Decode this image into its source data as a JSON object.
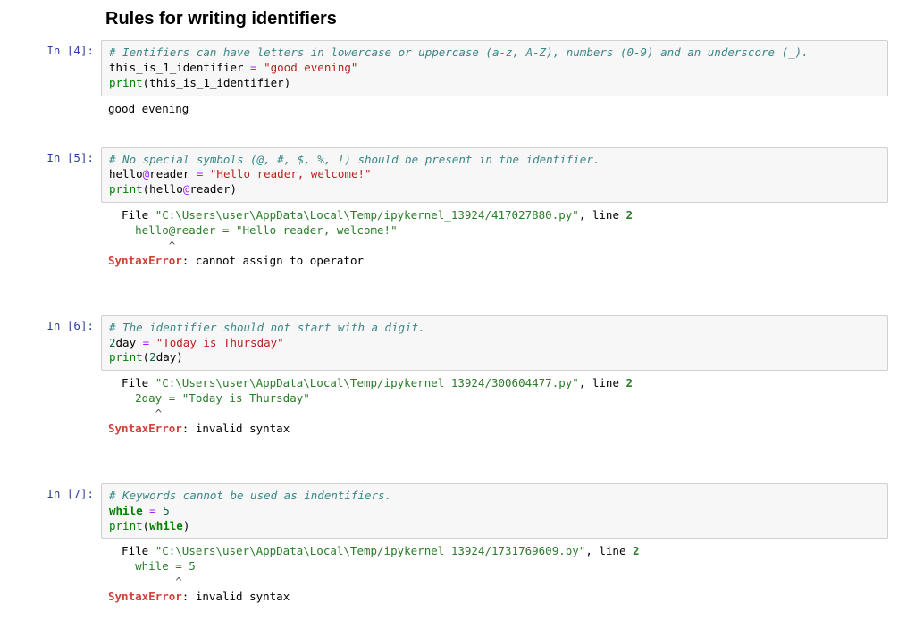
{
  "heading": "Rules for writing identifiers",
  "cells": {
    "c4": {
      "prompt": "In [4]:",
      "code": {
        "comment": "# Ientifiers can have letters in lowercase or uppercase (a-z, A-Z), numbers (0-9) and an underscore (_).",
        "l2_name": "this_is_1_identifier",
        "l2_eq": " = ",
        "l2_str": "\"good evening\"",
        "l3_fn": "print",
        "l3_open": "(",
        "l3_arg": "this_is_1_identifier",
        "l3_close": ")"
      },
      "output_text": "good evening"
    },
    "c5": {
      "prompt": "In [5]:",
      "code": {
        "comment": "# No special symbols (@, #, $, %, !) should be present in the identifier.",
        "l2_a": "hello",
        "l2_at": "@",
        "l2_b": "reader",
        "l2_eq": " = ",
        "l2_str": "\"Hello reader, welcome!\"",
        "l3_fn": "print",
        "l3_open": "(",
        "l3_arg_a": "hello",
        "l3_arg_at": "@",
        "l3_arg_b": "reader",
        "l3_close": ")"
      },
      "tb": {
        "file_lead": "  File ",
        "file_path": "\"C:\\Users\\user\\AppData\\Local\\Temp/ipykernel_13924/417027880.py\"",
        "file_tail": ", line ",
        "file_line": "2",
        "code_line": "    hello@reader = \"Hello reader, welcome!\"",
        "caret": "         ^",
        "err_name": "SyntaxError",
        "err_sep": ": ",
        "err_msg": "cannot assign to operator"
      }
    },
    "c6": {
      "prompt": "In [6]:",
      "code": {
        "comment": "# The identifier should not start with a digit.",
        "l2_num": "2",
        "l2_name": "day",
        "l2_eq": " = ",
        "l2_str": "\"Today is Thursday\"",
        "l3_fn": "print",
        "l3_open": "(",
        "l3_num": "2",
        "l3_name": "day",
        "l3_close": ")"
      },
      "tb": {
        "file_lead": "  File ",
        "file_path": "\"C:\\Users\\user\\AppData\\Local\\Temp/ipykernel_13924/300604477.py\"",
        "file_tail": ", line ",
        "file_line": "2",
        "code_line": "    2day = \"Today is Thursday\"",
        "caret": "       ^",
        "err_name": "SyntaxError",
        "err_sep": ": ",
        "err_msg": "invalid syntax"
      }
    },
    "c7": {
      "prompt": "In [7]:",
      "code": {
        "comment": "# Keywords cannot be used as indentifiers.",
        "l2_kw": "while",
        "l2_eq": " = ",
        "l2_num": "5",
        "l3_fn": "print",
        "l3_open": "(",
        "l3_kw": "while",
        "l3_close": ")"
      },
      "tb": {
        "file_lead": "  File ",
        "file_path": "\"C:\\Users\\user\\AppData\\Local\\Temp/ipykernel_13924/1731769609.py\"",
        "file_tail": ", line ",
        "file_line": "2",
        "code_line": "    while = 5",
        "caret": "          ^",
        "err_name": "SyntaxError",
        "err_sep": ": ",
        "err_msg": "invalid syntax"
      }
    }
  }
}
